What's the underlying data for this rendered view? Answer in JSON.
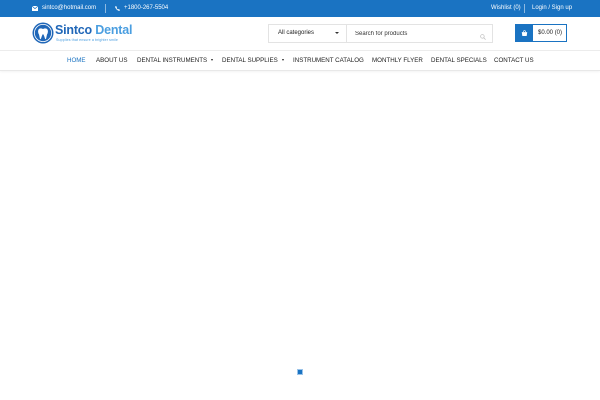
{
  "topbar": {
    "email": "sintco@hotmail.com",
    "phone": "+1800-267-5504",
    "wishlist": "Wishlist (0)",
    "login": "Login / Sign up",
    "background": "#1a73c2"
  },
  "header": {
    "logo_main": "Sintco",
    "logo_accent": "Dental",
    "logo_tagline": "Supplies that ensure a brighter smile",
    "search": {
      "category": "All categories",
      "placeholder": "Search for products"
    },
    "cart": {
      "total": "$0.00",
      "count": "(0)"
    }
  },
  "nav": {
    "items": [
      {
        "label": "HOME",
        "active": true
      },
      {
        "label": "ABOUT US"
      },
      {
        "label": "DENTAL INSTRUMENTS",
        "dropdown": true
      },
      {
        "label": "DENTAL SUPPLIES",
        "dropdown": true
      },
      {
        "label": "INSTRUMENT CATALOG"
      },
      {
        "label": "MONTHLY FLYER"
      },
      {
        "label": "DENTAL SPECIALS"
      },
      {
        "label": "CONTACT US"
      }
    ]
  },
  "icons": {
    "email": "envelope-icon",
    "phone": "phone-icon",
    "search": "search-icon",
    "cart": "shopping-bag-icon",
    "loader": "loading-icon"
  }
}
